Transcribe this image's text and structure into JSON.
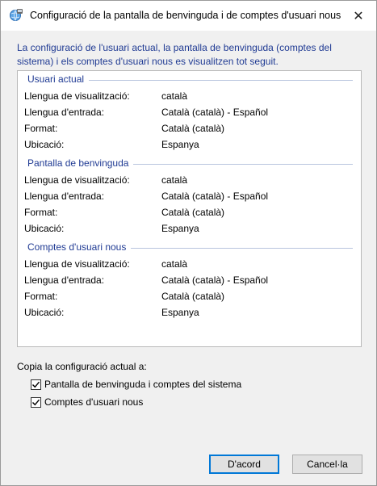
{
  "window": {
    "title": "Configuració de la pantalla de benvinguda i de comptes d'usuari nous",
    "close_glyph": "✕"
  },
  "description": "La configuració de l'usuari actual, la pantalla de benvinguda (comptes del sistema) i els comptes d'usuari nous es visualitzen tot seguit.",
  "sections": [
    {
      "title": "Usuari actual",
      "rows": [
        {
          "label": "Llengua de visualització:",
          "value": "català"
        },
        {
          "label": "Llengua d'entrada:",
          "value": "Català (català) - Español"
        },
        {
          "label": "Format:",
          "value": "Català (català)"
        },
        {
          "label": "Ubicació:",
          "value": "Espanya"
        }
      ]
    },
    {
      "title": "Pantalla de benvinguda",
      "rows": [
        {
          "label": "Llengua de visualització:",
          "value": "català"
        },
        {
          "label": "Llengua d'entrada:",
          "value": "Català (català) - Español"
        },
        {
          "label": "Format:",
          "value": "Català (català)"
        },
        {
          "label": "Ubicació:",
          "value": "Espanya"
        }
      ]
    },
    {
      "title": "Comptes d'usuari nous",
      "rows": [
        {
          "label": "Llengua de visualització:",
          "value": "català"
        },
        {
          "label": "Llengua d'entrada:",
          "value": "Català (català) - Español"
        },
        {
          "label": "Format:",
          "value": "Català (català)"
        },
        {
          "label": "Ubicació:",
          "value": "Espanya"
        }
      ]
    }
  ],
  "copy": {
    "label": "Copia la configuració actual a:",
    "options": [
      {
        "label": "Pantalla de benvinguda i comptes del sistema",
        "checked": true
      },
      {
        "label": "Comptes d'usuari nous",
        "checked": true
      }
    ]
  },
  "buttons": {
    "ok": "D'acord",
    "cancel": "Cancel·la"
  },
  "colors": {
    "accent_text": "#1f3a93",
    "default_button_border": "#0078d7"
  }
}
